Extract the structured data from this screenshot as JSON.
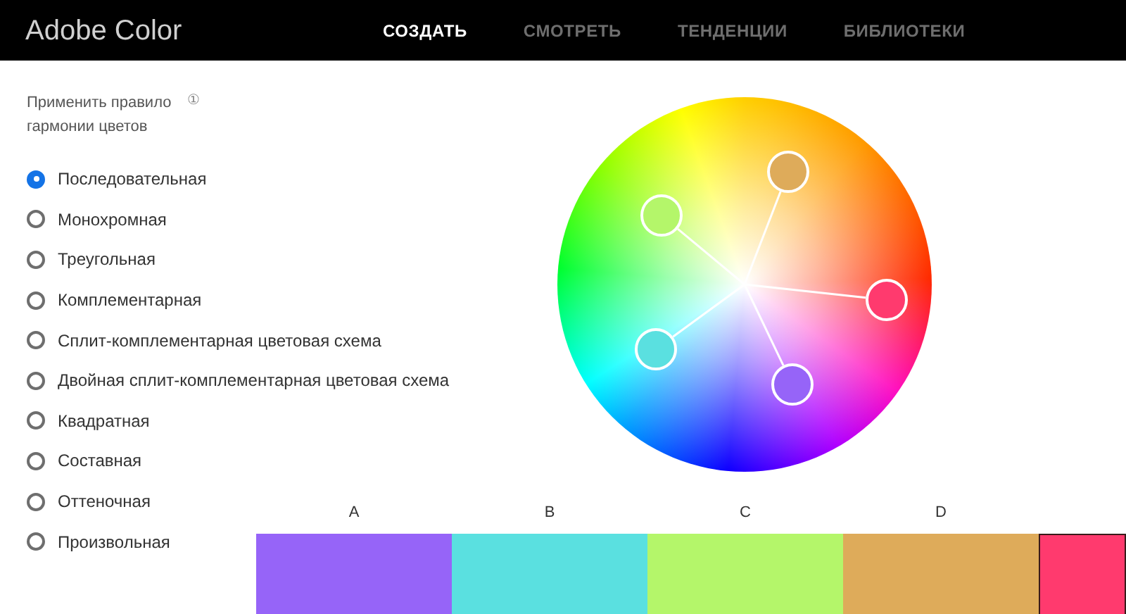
{
  "header": {
    "logo": "Adobe Color",
    "nav": [
      {
        "label": "СОЗДАТЬ",
        "selected": true
      },
      {
        "label": "СМОТРЕТЬ",
        "selected": false
      },
      {
        "label": "ТЕНДЕНЦИИ",
        "selected": false
      },
      {
        "label": "БИБЛИОТЕКИ",
        "selected": false
      }
    ]
  },
  "harmony": {
    "title": "Применить правило гармонии цветов",
    "info_icon": "①",
    "rules": [
      {
        "label": "Последовательная",
        "selected": true
      },
      {
        "label": "Монохромная",
        "selected": false
      },
      {
        "label": "Треугольная",
        "selected": false
      },
      {
        "label": "Комплементарная",
        "selected": false
      },
      {
        "label": "Сплит-комплементарная цветовая схема",
        "selected": false
      },
      {
        "label": "Двойная сплит-комплементарная цветовая схема",
        "selected": false
      },
      {
        "label": "Квадратная",
        "selected": false
      },
      {
        "label": "Составная",
        "selected": false
      },
      {
        "label": "Оттеночная",
        "selected": false
      },
      {
        "label": "Произвольная",
        "selected": false
      }
    ]
  },
  "swatches": [
    {
      "label": "A",
      "color": "#9664f8",
      "selected": false
    },
    {
      "label": "B",
      "color": "#5ae0e0",
      "selected": false
    },
    {
      "label": "C",
      "color": "#b4f66a",
      "selected": false
    },
    {
      "label": "D",
      "color": "#deab5a",
      "selected": false
    },
    {
      "color": "#ff3a6e",
      "selected": true
    }
  ]
}
